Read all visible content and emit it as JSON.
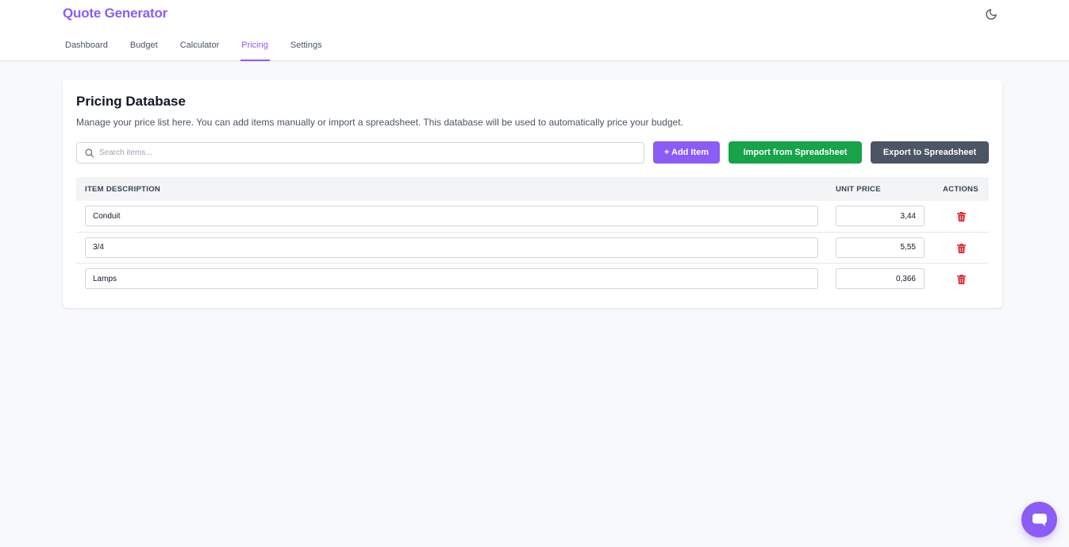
{
  "header": {
    "brand": "Quote Generator",
    "theme_icon": "moon-icon",
    "accent_color": "#8b5cf6"
  },
  "nav": {
    "tabs": [
      {
        "label": "Dashboard",
        "active": false
      },
      {
        "label": "Budget",
        "active": false
      },
      {
        "label": "Calculator",
        "active": false
      },
      {
        "label": "Pricing",
        "active": true
      },
      {
        "label": "Settings",
        "active": false
      }
    ]
  },
  "pricing": {
    "title": "Pricing Database",
    "description": "Manage your price list here. You can add items manually or import a spreadsheet. This database will be used to automatically price your budget.",
    "search": {
      "placeholder": "Search items...",
      "value": ""
    },
    "buttons": {
      "add": "+ Add Item",
      "import": "Import from Spreadsheet",
      "export": "Export to Spreadsheet"
    },
    "columns": {
      "description": "ITEM DESCRIPTION",
      "price": "UNIT PRICE",
      "actions": "ACTIONS"
    },
    "rows": [
      {
        "description": "Conduit",
        "price": "3,44"
      },
      {
        "description": "3/4",
        "price": "5,55"
      },
      {
        "description": "Lamps",
        "price": "0,366"
      }
    ]
  },
  "colors": {
    "add_button": "#8b5cf6",
    "import_button": "#16a34a",
    "export_button": "#4b5563",
    "delete_icon": "#dc2626"
  },
  "chat_icon": "chat-icon"
}
